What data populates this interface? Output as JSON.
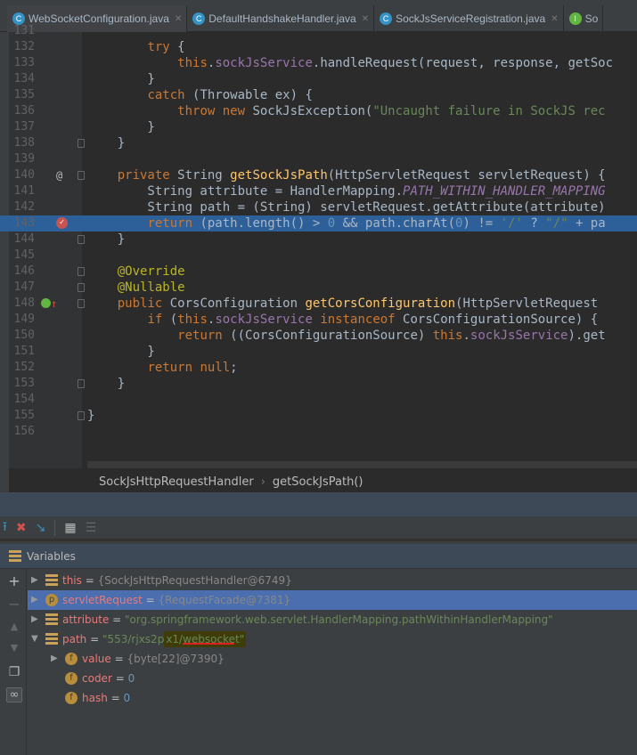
{
  "tabs": [
    {
      "label": "WebSocketConfiguration.java",
      "icon": "class-icon",
      "active": true
    },
    {
      "label": "DefaultHandshakeHandler.java",
      "icon": "class-locked-icon"
    },
    {
      "label": "SockJsServiceRegistration.java",
      "icon": "class-locked-icon"
    },
    {
      "label": "So",
      "icon": "interface-locked-icon"
    }
  ],
  "colors": {
    "keyword": "#cc7832",
    "method": "#ffc66d",
    "field": "#9876aa",
    "string": "#6a8759",
    "number": "#6897bb",
    "annotation": "#bbb529",
    "highlight": "#2d5f99"
  },
  "editor": {
    "current_line": 143,
    "lines": [
      {
        "n": "131",
        "s": []
      },
      {
        "n": "132",
        "s": [
          [
            "        ",
            ""
          ],
          [
            "try",
            "kw"
          ],
          [
            " {",
            ""
          ]
        ]
      },
      {
        "n": "133",
        "s": [
          [
            "            ",
            ""
          ],
          [
            "this",
            "kw"
          ],
          [
            ".",
            ""
          ],
          [
            "sockJsService",
            "fd"
          ],
          [
            ".handleRequest(request, response, getSoc",
            ""
          ]
        ]
      },
      {
        "n": "134",
        "s": [
          [
            "        }",
            ""
          ]
        ]
      },
      {
        "n": "135",
        "s": [
          [
            "        ",
            ""
          ],
          [
            "catch",
            "kw"
          ],
          [
            " (Throwable ex) {",
            ""
          ]
        ]
      },
      {
        "n": "136",
        "s": [
          [
            "            ",
            ""
          ],
          [
            "throw new",
            "kw"
          ],
          [
            " SockJsException(",
            ""
          ],
          [
            "\"Uncaught failure in SockJS rec",
            "st"
          ]
        ]
      },
      {
        "n": "137",
        "s": [
          [
            "        }",
            ""
          ]
        ]
      },
      {
        "n": "138",
        "s": [
          [
            "    }",
            ""
          ]
        ]
      },
      {
        "n": "139",
        "s": []
      },
      {
        "n": "140",
        "s": [
          [
            "    ",
            ""
          ],
          [
            "private",
            "kw"
          ],
          [
            " String ",
            ""
          ],
          [
            "getSockJsPath",
            "fn"
          ],
          [
            "(HttpServletRequest servletRequest) {",
            ""
          ]
        ],
        "gutter": "@"
      },
      {
        "n": "141",
        "s": [
          [
            "        String attribute = HandlerMapping.",
            ""
          ],
          [
            "PATH_WITHIN_HANDLER_MAPPING",
            "it"
          ]
        ]
      },
      {
        "n": "142",
        "s": [
          [
            "        String path = (String) servletRequest.getAttribute(attribute)",
            ""
          ]
        ]
      },
      {
        "n": "143",
        "s": [
          [
            "        ",
            ""
          ],
          [
            "return",
            "kw"
          ],
          [
            " (path.length() > ",
            ""
          ],
          [
            "0",
            "nm"
          ],
          [
            " && path.charAt(",
            ""
          ],
          [
            "0",
            "nm"
          ],
          [
            ") != ",
            ""
          ],
          [
            "'/'",
            "st"
          ],
          [
            " ? ",
            ""
          ],
          [
            "\"/\"",
            "st"
          ],
          [
            " + pa",
            ""
          ]
        ],
        "gutter": "breakpoint"
      },
      {
        "n": "144",
        "s": [
          [
            "    }",
            ""
          ]
        ]
      },
      {
        "n": "145",
        "s": []
      },
      {
        "n": "146",
        "s": [
          [
            "    ",
            ""
          ],
          [
            "@Override",
            "an"
          ]
        ]
      },
      {
        "n": "147",
        "s": [
          [
            "    ",
            ""
          ],
          [
            "@Nullable",
            "an"
          ]
        ]
      },
      {
        "n": "148",
        "s": [
          [
            "    ",
            ""
          ],
          [
            "public",
            "kw"
          ],
          [
            " CorsConfiguration ",
            ""
          ],
          [
            "getCorsConfiguration",
            "fn"
          ],
          [
            "(HttpServletRequest ",
            ""
          ]
        ],
        "gutter": "implements"
      },
      {
        "n": "149",
        "s": [
          [
            "        ",
            ""
          ],
          [
            "if",
            "kw"
          ],
          [
            " (",
            ""
          ],
          [
            "this",
            "kw"
          ],
          [
            ".",
            ""
          ],
          [
            "sockJsService",
            "fd"
          ],
          [
            " ",
            ""
          ],
          [
            "instanceof",
            "kw"
          ],
          [
            " CorsConfigurationSource) {",
            ""
          ]
        ]
      },
      {
        "n": "150",
        "s": [
          [
            "            ",
            ""
          ],
          [
            "return",
            "kw"
          ],
          [
            " ((CorsConfigurationSource) ",
            ""
          ],
          [
            "this",
            "kw"
          ],
          [
            ".",
            ""
          ],
          [
            "sockJsService",
            "fd"
          ],
          [
            ").get",
            ""
          ]
        ]
      },
      {
        "n": "151",
        "s": [
          [
            "        }",
            ""
          ]
        ]
      },
      {
        "n": "152",
        "s": [
          [
            "        ",
            ""
          ],
          [
            "return null",
            "kw"
          ],
          [
            ";",
            ""
          ]
        ]
      },
      {
        "n": "153",
        "s": [
          [
            "    }",
            ""
          ]
        ]
      },
      {
        "n": "154",
        "s": []
      },
      {
        "n": "155",
        "s": [
          [
            "}",
            ""
          ]
        ]
      },
      {
        "n": "156",
        "s": []
      }
    ]
  },
  "breadcrumb": {
    "class": "SockJsHttpRequestHandler",
    "sep": "›",
    "method": "getSockJsPath()"
  },
  "toolbar": {
    "icons": [
      "step-out-icon",
      "drop-frame-icon",
      "run-to-cursor-icon",
      "evaluate-icon",
      "trace-icon"
    ]
  },
  "variables": {
    "title": "Variables",
    "rows": [
      {
        "name": "this",
        "eq": " = ",
        "value": "{SockJsHttpRequestHandler@6749}",
        "vclass": "vdef",
        "icon": "bars",
        "arrow": "▶",
        "indent": 0
      },
      {
        "name": "servletRequest",
        "eq": " = ",
        "value": "{RequestFacade@7381}",
        "vclass": "vdef",
        "icon": "p",
        "arrow": "▶",
        "indent": 0,
        "selected": true
      },
      {
        "name": "attribute",
        "eq": " = ",
        "value": "\"org.springframework.web.servlet.HandlerMapping.pathWithinHandlerMapping\"",
        "vclass": "vstr",
        "icon": "bars",
        "arrow": "▶",
        "indent": 0
      },
      {
        "name": "path",
        "eq": " = ",
        "value_a": "\"553/rjxs2p",
        "value_b": "x1/",
        "value_c": "websocket",
        "value_d": "\"",
        "vclass": "vstr",
        "icon": "bars",
        "arrow": "▼",
        "indent": 0
      },
      {
        "name": "value",
        "eq": " = ",
        "value": "{byte[22]@7390}",
        "vclass": "vdef",
        "icon": "f",
        "arrow": "▶",
        "indent": 1
      },
      {
        "name": "coder",
        "eq": " = ",
        "value": "0",
        "vclass": "vnum",
        "icon": "f",
        "arrow": "",
        "indent": 1
      },
      {
        "name": "hash",
        "eq": " = ",
        "value": "0",
        "vclass": "vnum",
        "icon": "f",
        "arrow": "",
        "indent": 1
      }
    ]
  }
}
